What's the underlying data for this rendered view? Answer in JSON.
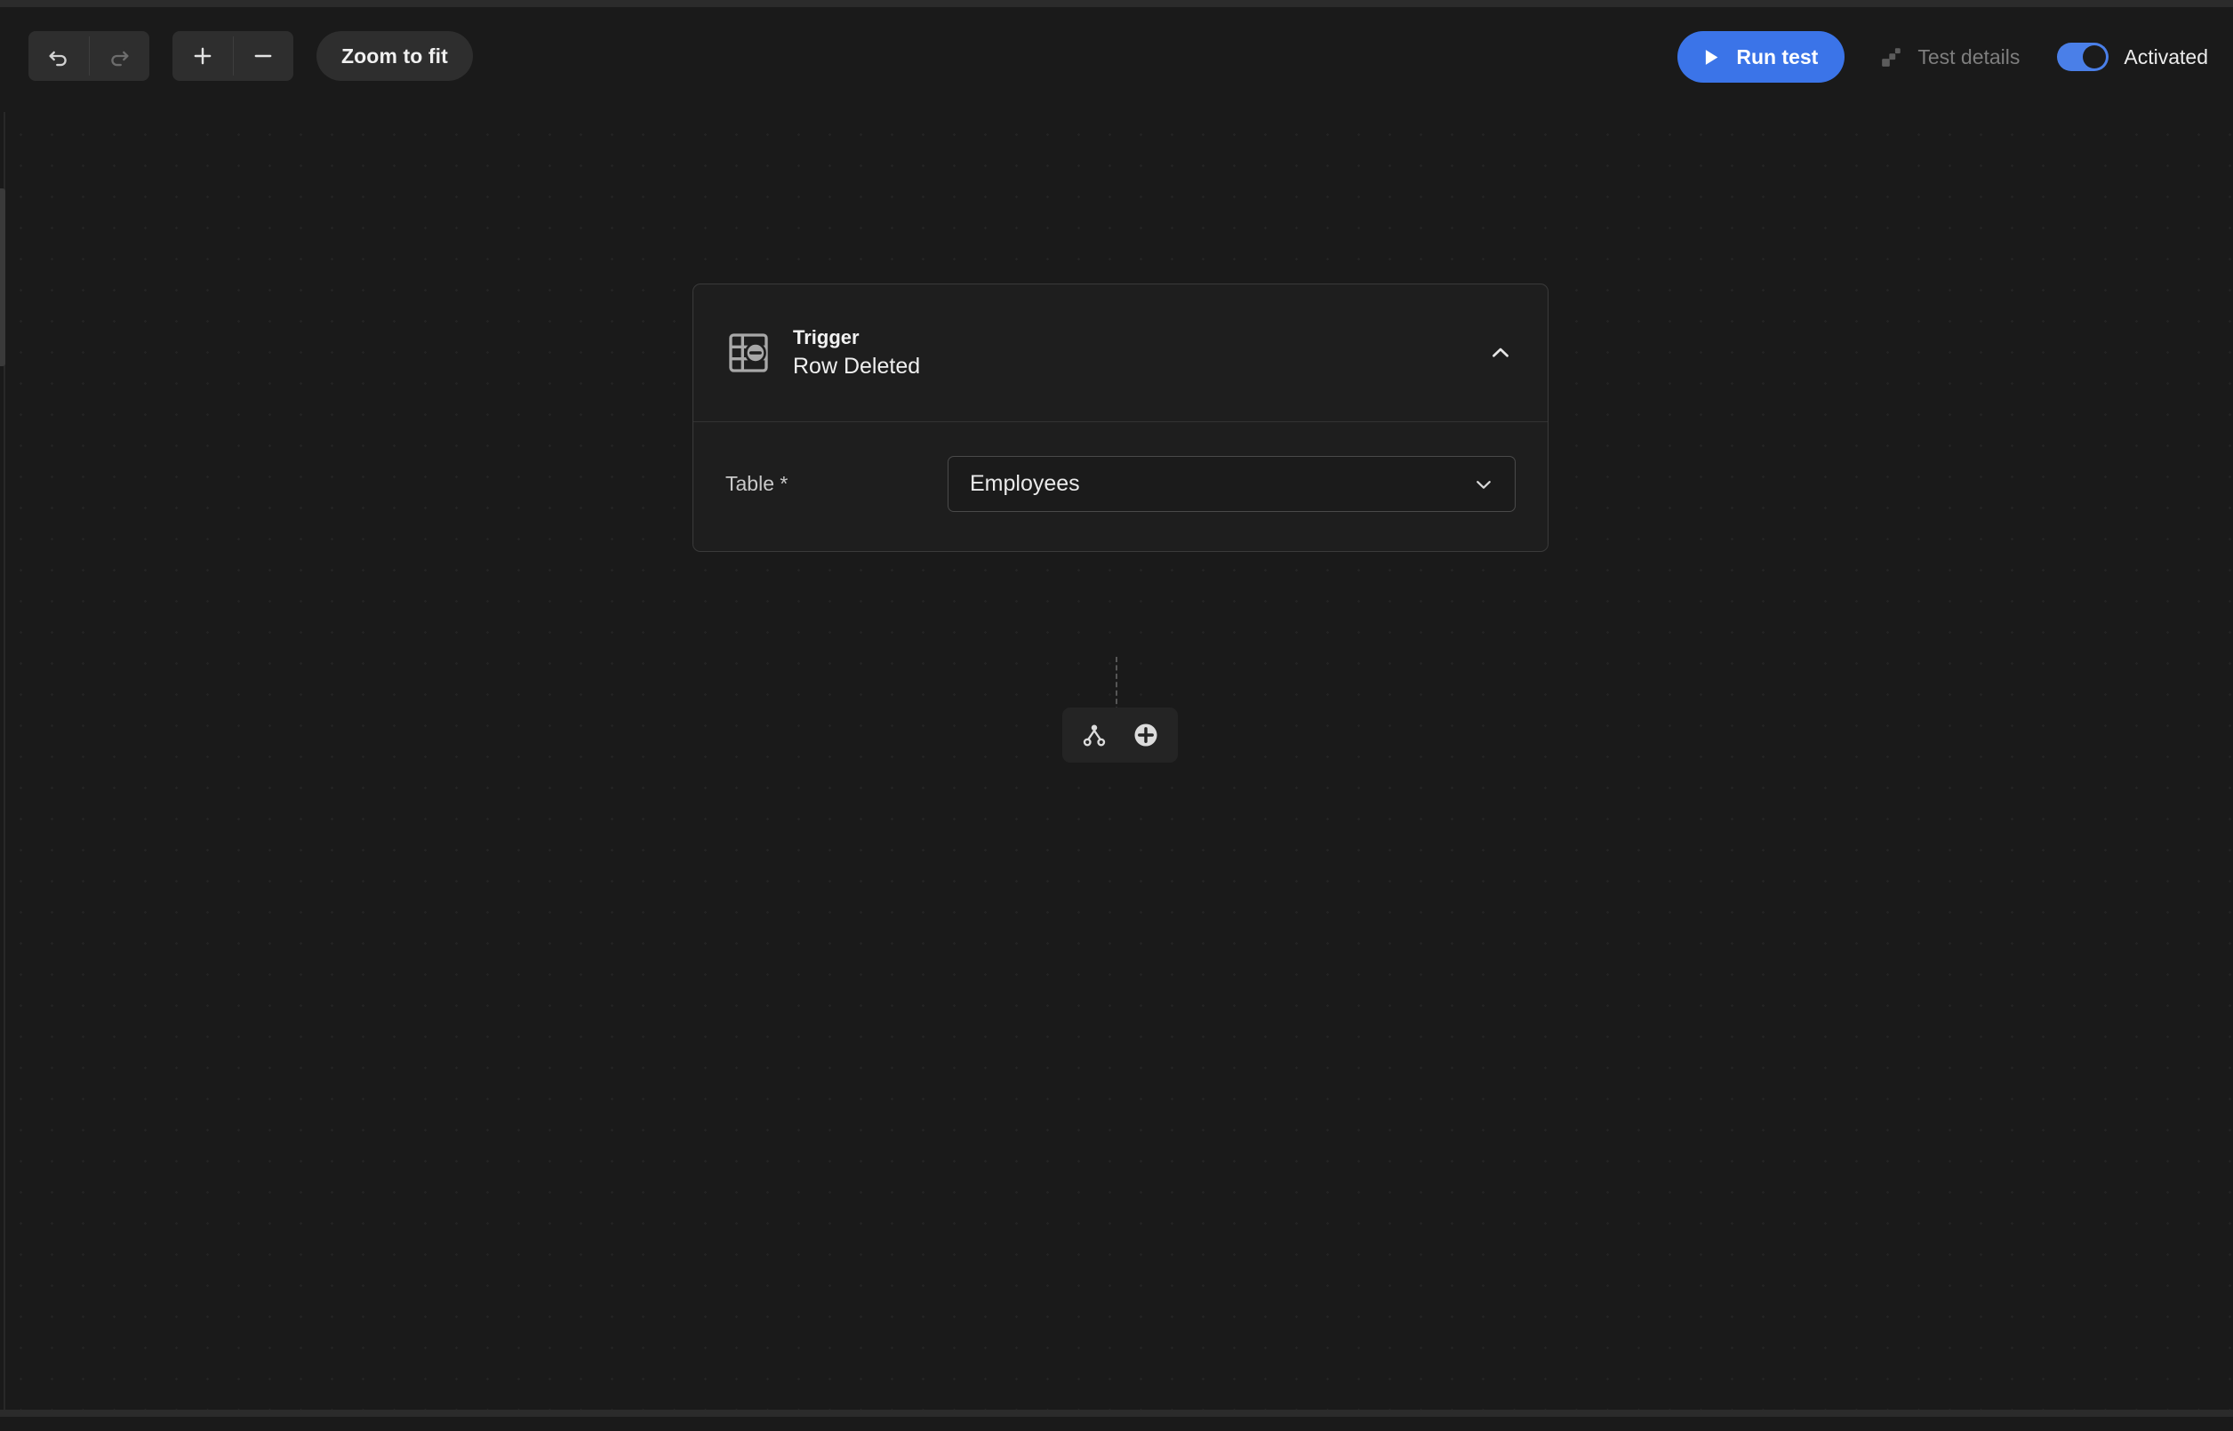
{
  "app": {
    "theme": "dark",
    "accent_color": "#3b74e8",
    "canvas_bg": "#1a1a1a",
    "card_bg": "#1e1e1e"
  },
  "toolbar": {
    "undo": {
      "label": "Undo",
      "icon": "undo-icon",
      "enabled": true
    },
    "redo": {
      "label": "Redo",
      "icon": "redo-icon",
      "enabled": false
    },
    "zoom_in": {
      "label": "Zoom in",
      "icon": "plus-icon"
    },
    "zoom_out": {
      "label": "Zoom out",
      "icon": "minus-icon"
    },
    "zoom_to_fit_label": "Zoom to fit"
  },
  "header_actions": {
    "run_test_label": "Run test",
    "run_test_icon": "play-icon",
    "test_details_label": "Test details",
    "test_details_icon": "stacked-squares-icon",
    "activated_label": "Activated",
    "activated_state": "on",
    "toggle_on_color": "#4a7fe8"
  },
  "workflow": {
    "node": {
      "icon": "table-row-deleted-icon",
      "kind_label": "Trigger",
      "name_label": "Row Deleted",
      "collapse_icon": "chevron-up-icon",
      "collapsed": false,
      "fields": [
        {
          "label": "Table *",
          "control": "select",
          "value": "Employees",
          "chevron_icon": "chevron-down-icon"
        }
      ]
    },
    "connector": {
      "style": "dashed",
      "actions": [
        {
          "name": "add-branch",
          "icon": "branch-icon"
        },
        {
          "name": "add-step",
          "icon": "plus-circle-icon"
        }
      ]
    }
  }
}
